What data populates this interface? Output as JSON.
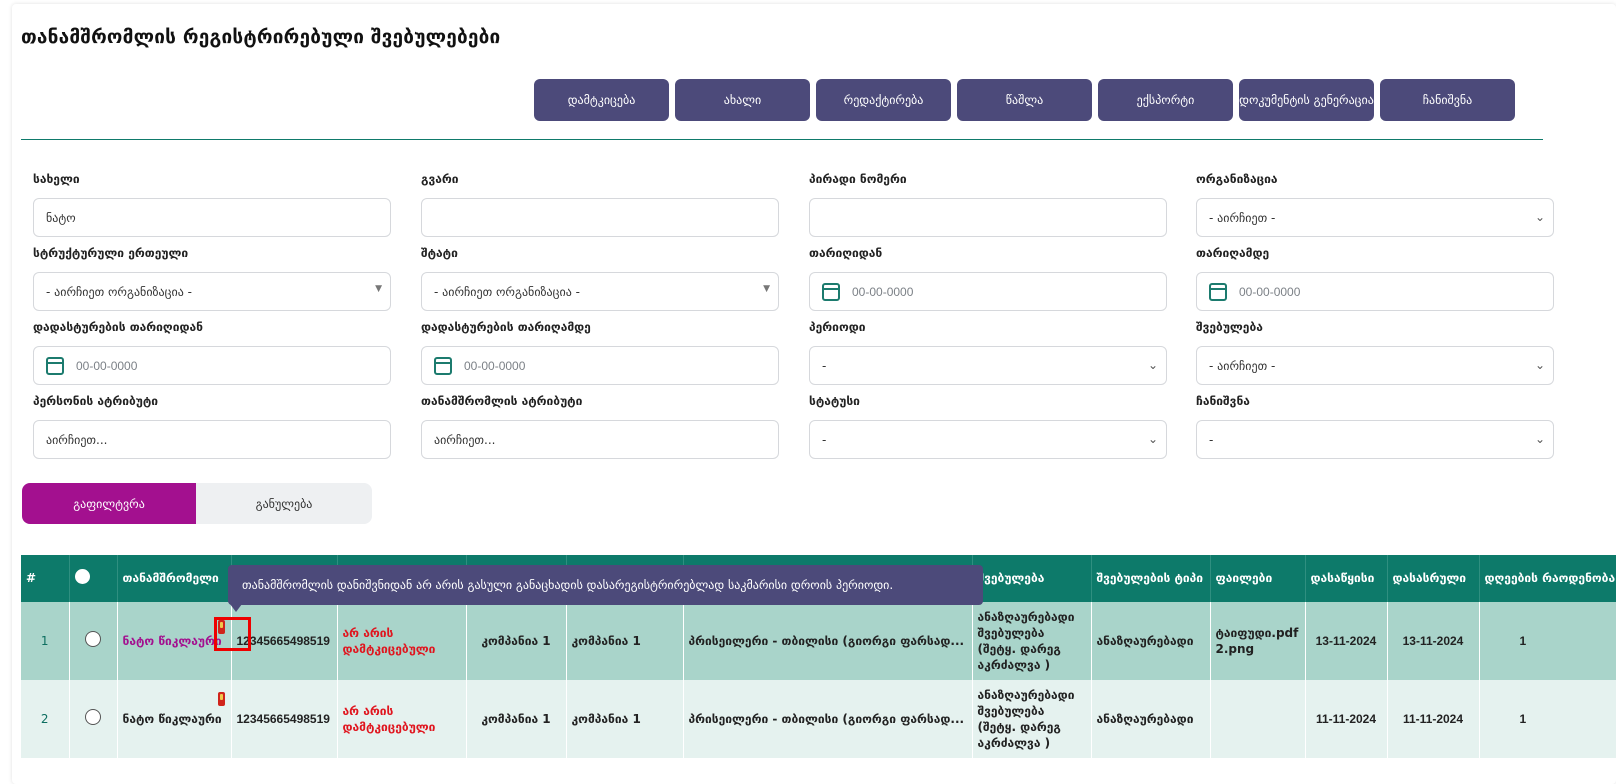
{
  "title": "თანამშრომლის რეგისტრირებული შვებულებები",
  "toolbar": [
    "დამტკიცება",
    "ახალი",
    "რედაქტირება",
    "წაშლა",
    "ექსპორტი",
    "დოკუმენტის გენერაცია",
    "ჩანიშვნა"
  ],
  "filters": {
    "name": {
      "label": "სახელი",
      "value": "ნატო"
    },
    "surname": {
      "label": "გვარი",
      "value": ""
    },
    "personal_no": {
      "label": "პირადი ნომერი",
      "value": ""
    },
    "organization": {
      "label": "ორგანიზაცია",
      "value": "- აირჩიეთ -"
    },
    "unit": {
      "label": "სტრუქტურული ერთეული",
      "value": "- აირჩიეთ ორგანიზაცია -"
    },
    "staff": {
      "label": "შტატი",
      "value": "- აირჩიეთ ორგანიზაცია -"
    },
    "date_from": {
      "label": "თარიღიდან",
      "placeholder": "00-00-0000"
    },
    "date_to": {
      "label": "თარიღამდე",
      "placeholder": "00-00-0000"
    },
    "confirm_from": {
      "label": "დადასტურების თარიღიდან",
      "placeholder": "00-00-0000"
    },
    "confirm_to": {
      "label": "დადასტურების თარიღამდე",
      "placeholder": "00-00-0000"
    },
    "period": {
      "label": "პერიოდი",
      "value": "-"
    },
    "leave": {
      "label": "შვებულება",
      "value": "- აირჩიეთ -"
    },
    "person_attr": {
      "label": "პერსონის ატრიბუტი",
      "value": "აირჩიეთ..."
    },
    "employee_attr": {
      "label": "თანამშრომლის ატრიბუტი",
      "value": "აირჩიეთ..."
    },
    "status": {
      "label": "სტატუსი",
      "value": "-"
    },
    "mark": {
      "label": "ჩანიშვნა",
      "value": "-"
    }
  },
  "buttons": {
    "filter": "გაფილტვრა",
    "reset": "განულება"
  },
  "table": {
    "headers": [
      "#",
      "",
      "თანამშრომელი",
      "",
      "",
      "",
      "",
      "",
      "შვებულება",
      "შვებულების ტიპი",
      "ფაილები",
      "დასაწყისი",
      "დასასრული",
      "დღეების რაოდენობა"
    ],
    "rows": [
      {
        "num": "1",
        "employee": "ნატო წიკლაური",
        "personal_no": "12345665498519",
        "status": "არ არის დამტკიცებული",
        "org": "კომპანია 1",
        "unit": "კომპანია 1",
        "position": "პრისეილერი - თბილისი (გიორგი ფარსად...",
        "leave": "ანაზღაურებადი შვებულება (შეტყ. დარეგ აკრძალვა )",
        "leave_type": "ანაზღაურებადი",
        "files": "ტაიფუდი.pdf 2.png",
        "start": "13-11-2024",
        "end": "13-11-2024",
        "days": "1"
      },
      {
        "num": "2",
        "employee": "ნატო წიკლაური",
        "personal_no": "12345665498519",
        "status": "არ არის დამტკიცებული",
        "org": "კომპანია 1",
        "unit": "კომპანია 1",
        "position": "პრისეილერი - თბილისი (გიორგი ფარსად...",
        "leave": "ანაზღაურებადი შვებულება (შეტყ. დარეგ აკრძალვა )",
        "leave_type": "ანაზღაურებადი",
        "files": "",
        "start": "11-11-2024",
        "end": "11-11-2024",
        "days": "1"
      }
    ]
  },
  "tooltip": "თანამშრომლის დანიშვნიდან არ არის გასული განაცხადის დასარეგისტრირებლად საკმარისი დროის პერიოდი."
}
